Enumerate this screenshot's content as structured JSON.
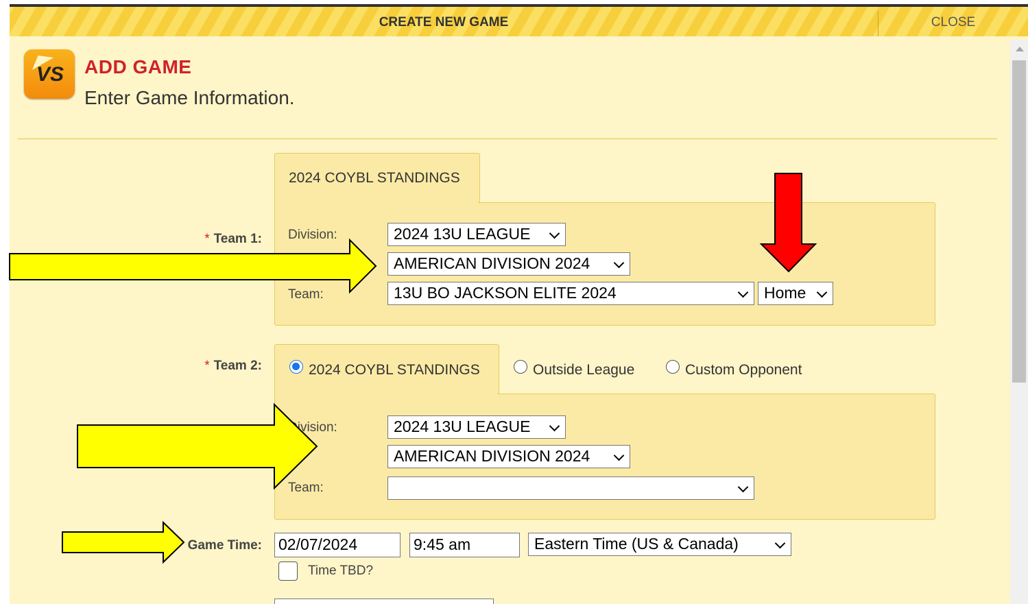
{
  "titlebar": {
    "title": "CREATE NEW GAME",
    "close_label": "CLOSE"
  },
  "header": {
    "title": "ADD GAME",
    "subtitle": "Enter Game Information.",
    "logo_text": "VS"
  },
  "team1": {
    "required_mark": "*",
    "label": "Team 1:",
    "tab_label": "2024 COYBL STANDINGS",
    "division_label": "Division:",
    "division_value": "2024 13U LEAGUE",
    "subdivision_value": "AMERICAN DIVISION 2024",
    "team_label": "Team:",
    "team_value": "13U BO JACKSON ELITE 2024",
    "home_away_value": "Home"
  },
  "team2": {
    "required_mark": "*",
    "label": "Team 2:",
    "options": [
      "2024 COYBL STANDINGS",
      "Outside League",
      "Custom Opponent"
    ],
    "selected_option": "2024 COYBL STANDINGS",
    "division_label": "Division:",
    "division_value": "2024 13U LEAGUE",
    "subdivision_value": "AMERICAN DIVISION 2024",
    "team_label": "Team:",
    "team_value": ""
  },
  "game_time": {
    "label": "Game Time:",
    "date_value": "02/07/2024",
    "time_value": "9:45 am",
    "timezone_value": "Eastern Time (US & Canada)",
    "tbd_label": "Time TBD?",
    "tbd_checked": false
  },
  "colors": {
    "accent_red": "#d0212e",
    "arrow_yellow": "#ffff00",
    "arrow_red": "#ff0000",
    "panel": "#fbeaa5"
  }
}
